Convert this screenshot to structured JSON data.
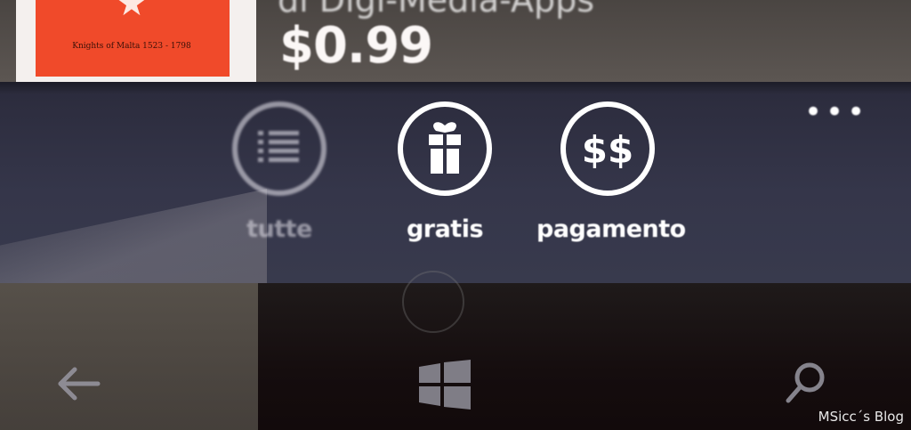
{
  "app_item": {
    "subtitle": "di Digi-Media-Apps",
    "price": "$0.99",
    "thumbnail_caption": "Knights of Malta 1523 - 1798"
  },
  "app_bar": {
    "buttons": [
      {
        "label": "tutte",
        "icon": "list-icon"
      },
      {
        "label": "gratis",
        "icon": "gift-icon"
      },
      {
        "label": "pagamento",
        "icon": "dollar-icon"
      }
    ],
    "more_label": "•••"
  },
  "hardware_buttons": {
    "back": "back-arrow-icon",
    "start": "windows-logo-icon",
    "search": "search-icon"
  },
  "watermark": "MSicc´s Blog",
  "colors": {
    "app_bar_background": "#35364a",
    "thumbnail_red": "#f04a2a",
    "foreground": "#ffffff"
  }
}
